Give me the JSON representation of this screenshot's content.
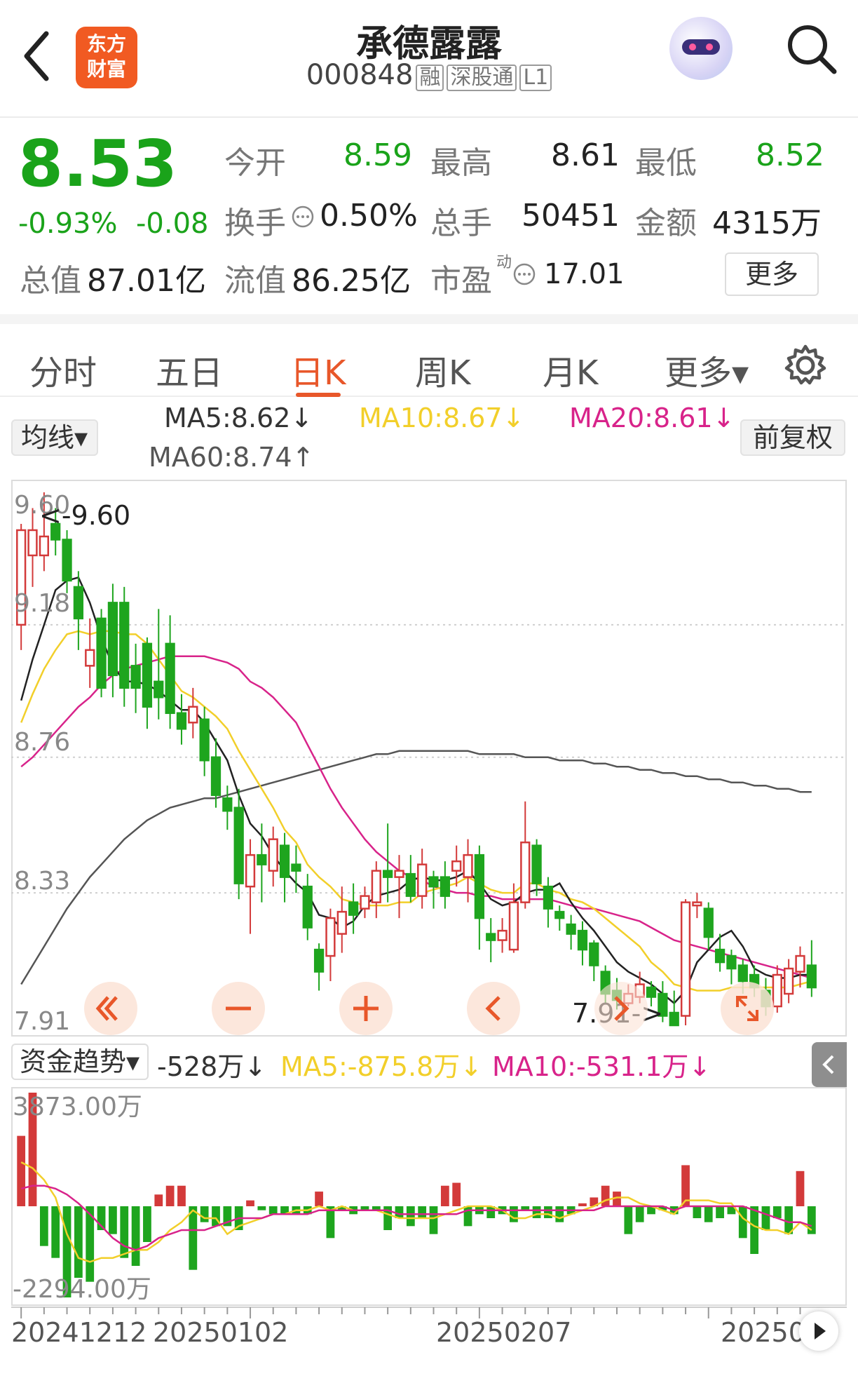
{
  "header": {
    "back_label": "back",
    "logo_text_1": "东方",
    "logo_text_2": "财富",
    "stock_name": "承德露露",
    "stock_code": "000848",
    "tags": [
      "融",
      "深股通",
      "L1"
    ]
  },
  "quote": {
    "price": "8.53",
    "change_pct": "-0.93%",
    "change_abs": "-0.08",
    "open_label": "今开",
    "open": "8.59",
    "high_label": "最高",
    "high": "8.61",
    "low_label": "最低",
    "low": "8.52",
    "turnover_label": "换手",
    "turnover": "0.50%",
    "volume_label": "总手",
    "volume": "50451",
    "amount_label": "金额",
    "amount": "4315万",
    "mktcap_label": "总值",
    "mktcap": "87.01亿",
    "float_label": "流值",
    "float_cap": "86.25亿",
    "pe_label": "市盈",
    "pe_sup": "动",
    "pe": "17.01",
    "more_label": "更多"
  },
  "tabs": [
    "分时",
    "五日",
    "日K",
    "周K",
    "月K",
    "更多▾"
  ],
  "active_tab": "日K",
  "kline": {
    "indicator_select": "均线▾",
    "ma5": "MA5:8.62↓",
    "ma10": "MA10:8.67↓",
    "ma20": "MA20:8.61↓",
    "ma60": "MA60:8.74↑",
    "adjust_button": "前复权",
    "y_ticks": [
      "9.60",
      "9.18",
      "8.76",
      "8.33",
      "7.91"
    ],
    "high_marker": "<-9.60",
    "low_marker": "7.91->",
    "colors": {
      "ma5": "#222222",
      "ma10": "#f2cf2a",
      "ma20": "#d8238a",
      "ma60": "#555555",
      "up": "#d33a3a",
      "down": "#1ea51e"
    }
  },
  "fund": {
    "select": "资金趋势▾",
    "value": "-528万↓",
    "ma5": "MA5:-875.8万↓",
    "ma10": "MA10:-531.1万↓",
    "y_top": "3873.00万",
    "y_bottom": "-2294.00万",
    "dates": [
      "20241212",
      "20250102",
      "20250207",
      "20250"
    ]
  },
  "chart_data": {
    "type": "candlestick",
    "ylim": [
      7.91,
      9.6
    ],
    "candles": [
      [
        9.18,
        9.48,
        9.5,
        9.1
      ],
      [
        9.4,
        9.48,
        9.55,
        9.3
      ],
      [
        9.4,
        9.46,
        9.6,
        9.35
      ],
      [
        9.5,
        9.45,
        9.55,
        9.4
      ],
      [
        9.45,
        9.32,
        9.48,
        9.28
      ],
      [
        9.3,
        9.2,
        9.35,
        9.1
      ],
      [
        9.05,
        9.1,
        9.2,
        8.98
      ],
      [
        9.2,
        8.98,
        9.23,
        8.95
      ],
      [
        9.25,
        9.02,
        9.31,
        8.95
      ],
      [
        9.25,
        8.98,
        9.3,
        8.92
      ],
      [
        9.05,
        8.98,
        9.12,
        8.9
      ],
      [
        9.12,
        8.92,
        9.14,
        8.85
      ],
      [
        9.0,
        8.95,
        9.23,
        8.88
      ],
      [
        9.12,
        8.9,
        9.21,
        8.85
      ],
      [
        8.9,
        8.85,
        8.96,
        8.8
      ],
      [
        8.87,
        8.92,
        8.98,
        8.82
      ],
      [
        8.88,
        8.75,
        8.92,
        8.7
      ],
      [
        8.76,
        8.64,
        8.82,
        8.6
      ],
      [
        8.63,
        8.59,
        8.67,
        8.53
      ],
      [
        8.6,
        8.36,
        8.66,
        8.31
      ],
      [
        8.35,
        8.45,
        8.5,
        8.2
      ],
      [
        8.45,
        8.42,
        8.55,
        8.3
      ],
      [
        8.4,
        8.5,
        8.54,
        8.35
      ],
      [
        8.48,
        8.38,
        8.52,
        8.3
      ],
      [
        8.42,
        8.4,
        8.48,
        8.33
      ],
      [
        8.35,
        8.22,
        8.39,
        8.18
      ],
      [
        8.15,
        8.08,
        8.17,
        8.02
      ],
      [
        8.13,
        8.25,
        8.28,
        8.05
      ],
      [
        8.2,
        8.27,
        8.35,
        8.14
      ],
      [
        8.3,
        8.26,
        8.36,
        8.2
      ],
      [
        8.28,
        8.32,
        8.35,
        8.25
      ],
      [
        8.3,
        8.4,
        8.43,
        8.25
      ],
      [
        8.4,
        8.38,
        8.55,
        8.3
      ],
      [
        8.38,
        8.4,
        8.45,
        8.25
      ],
      [
        8.39,
        8.32,
        8.45,
        8.3
      ],
      [
        8.32,
        8.42,
        8.47,
        8.28
      ],
      [
        8.38,
        8.35,
        8.4,
        8.28
      ],
      [
        8.38,
        8.32,
        8.43,
        8.28
      ],
      [
        8.4,
        8.43,
        8.48,
        8.35
      ],
      [
        8.38,
        8.45,
        8.5,
        8.3
      ],
      [
        8.45,
        8.25,
        8.48,
        8.15
      ],
      [
        8.2,
        8.18,
        8.25,
        8.11
      ],
      [
        8.18,
        8.21,
        8.25,
        8.14
      ],
      [
        8.15,
        8.3,
        8.36,
        8.14
      ],
      [
        8.3,
        8.49,
        8.62,
        8.28
      ],
      [
        8.48,
        8.36,
        8.5,
        8.32
      ],
      [
        8.35,
        8.28,
        8.38,
        8.22
      ],
      [
        8.27,
        8.25,
        8.29,
        8.21
      ],
      [
        8.23,
        8.2,
        8.26,
        8.15
      ],
      [
        8.21,
        8.15,
        8.24,
        8.1
      ],
      [
        8.17,
        8.1,
        8.18,
        8.05
      ],
      [
        8.08,
        8.01,
        8.1,
        7.98
      ],
      [
        8.02,
        7.99,
        8.06,
        7.96
      ],
      [
        7.98,
        8.01,
        8.04,
        7.97
      ],
      [
        8.0,
        8.04,
        8.08,
        7.98
      ],
      [
        8.03,
        8.0,
        8.05,
        7.97
      ],
      [
        8.01,
        7.94,
        8.05,
        7.92
      ],
      [
        7.95,
        7.91,
        8.02,
        7.91
      ],
      [
        7.94,
        8.3,
        8.31,
        7.91
      ],
      [
        8.29,
        8.3,
        8.33,
        8.25
      ],
      [
        8.28,
        8.19,
        8.3,
        8.15
      ],
      [
        8.15,
        8.11,
        8.2,
        8.08
      ],
      [
        8.13,
        8.09,
        8.15,
        8.04
      ],
      [
        8.1,
        8.05,
        8.12,
        8.01
      ],
      [
        8.07,
        8.03,
        8.1,
        8.0
      ],
      [
        8.02,
        7.97,
        8.06,
        7.94
      ],
      [
        7.97,
        8.07,
        8.1,
        7.95
      ],
      [
        8.01,
        8.09,
        8.12,
        7.98
      ],
      [
        8.08,
        8.13,
        8.16,
        8.03
      ],
      [
        8.1,
        8.03,
        8.18,
        8.0
      ]
    ],
    "ma5": [
      8.94,
      9.07,
      9.18,
      9.29,
      9.32,
      9.33,
      9.25,
      9.14,
      9.05,
      9.0,
      9.0,
      8.99,
      8.97,
      8.94,
      8.91,
      8.91,
      8.87,
      8.81,
      8.75,
      8.64,
      8.55,
      8.51,
      8.45,
      8.4,
      8.36,
      8.33,
      8.26,
      8.25,
      8.22,
      8.24,
      8.29,
      8.32,
      8.33,
      8.34,
      8.37,
      8.38,
      8.37,
      8.37,
      8.38,
      8.4,
      8.36,
      8.31,
      8.29,
      8.3,
      8.33,
      8.34,
      8.34,
      8.36,
      8.3,
      8.25,
      8.21,
      8.16,
      8.11,
      8.08,
      8.06,
      8.04,
      8.01,
      7.98,
      8.02,
      8.11,
      8.15,
      8.19,
      8.21,
      8.16,
      8.09,
      8.07,
      8.06,
      8.06,
      8.07,
      8.07
    ],
    "ma10": [
      8.87,
      8.96,
      9.04,
      9.1,
      9.15,
      9.16,
      9.15,
      9.16,
      9.16,
      9.15,
      9.15,
      9.12,
      9.07,
      9.02,
      8.97,
      8.95,
      8.92,
      8.89,
      8.85,
      8.78,
      8.72,
      8.66,
      8.6,
      8.53,
      8.49,
      8.42,
      8.38,
      8.35,
      8.31,
      8.3,
      8.29,
      8.29,
      8.29,
      8.3,
      8.3,
      8.33,
      8.34,
      8.35,
      8.36,
      8.38,
      8.36,
      8.34,
      8.33,
      8.33,
      8.36,
      8.36,
      8.34,
      8.33,
      8.31,
      8.3,
      8.28,
      8.25,
      8.22,
      8.19,
      8.16,
      8.11,
      8.08,
      8.04,
      8.03,
      8.02,
      8.02,
      8.02,
      8.03,
      8.03,
      8.03,
      8.03,
      8.03,
      8.03,
      8.04,
      8.05
    ],
    "ma20": [
      8.73,
      8.76,
      8.8,
      8.84,
      8.88,
      8.92,
      8.95,
      8.99,
      9.02,
      9.04,
      9.05,
      9.06,
      9.07,
      9.08,
      9.08,
      9.08,
      9.08,
      9.07,
      9.06,
      9.04,
      9.0,
      8.98,
      8.95,
      8.91,
      8.87,
      8.8,
      8.73,
      8.66,
      8.6,
      8.55,
      8.5,
      8.46,
      8.43,
      8.4,
      8.38,
      8.37,
      8.35,
      8.34,
      8.33,
      8.33,
      8.32,
      8.32,
      8.31,
      8.31,
      8.31,
      8.31,
      8.31,
      8.3,
      8.29,
      8.28,
      8.28,
      8.27,
      8.26,
      8.25,
      8.24,
      8.22,
      8.2,
      8.18,
      8.17,
      8.16,
      8.15,
      8.14,
      8.13,
      8.12,
      8.11,
      8.1,
      8.09,
      8.08,
      8.07,
      8.06
    ],
    "ma60": [
      8.04,
      8.1,
      8.16,
      8.22,
      8.28,
      8.33,
      8.38,
      8.42,
      8.46,
      8.5,
      8.53,
      8.56,
      8.58,
      8.6,
      8.61,
      8.62,
      8.63,
      8.63,
      8.64,
      8.65,
      8.66,
      8.67,
      8.68,
      8.69,
      8.7,
      8.71,
      8.72,
      8.73,
      8.74,
      8.75,
      8.76,
      8.77,
      8.77,
      8.78,
      8.78,
      8.78,
      8.78,
      8.78,
      8.78,
      8.78,
      8.77,
      8.77,
      8.77,
      8.77,
      8.76,
      8.76,
      8.76,
      8.75,
      8.75,
      8.75,
      8.74,
      8.74,
      8.73,
      8.73,
      8.72,
      8.72,
      8.71,
      8.71,
      8.7,
      8.7,
      8.69,
      8.69,
      8.68,
      8.68,
      8.67,
      8.67,
      8.66,
      8.66,
      8.65,
      8.65
    ],
    "fund_flow_wan": [
      2400,
      3873,
      -1000,
      -1300,
      -2294,
      -1800,
      -1900,
      -600,
      -700,
      -1300,
      -1500,
      -900,
      400,
      700,
      700,
      -1600,
      -400,
      -500,
      -500,
      -600,
      200,
      -100,
      -200,
      -200,
      -200,
      -200,
      500,
      -800,
      -100,
      -200,
      -100,
      -100,
      -600,
      -300,
      -500,
      -300,
      -700,
      700,
      800,
      -500,
      -200,
      -300,
      -200,
      -400,
      -100,
      -300,
      -300,
      -400,
      -200,
      100,
      300,
      700,
      500,
      -700,
      -400,
      -200,
      -100,
      -200,
      1400,
      -300,
      -400,
      -300,
      -200,
      -800,
      -1200,
      -600,
      -300,
      -700,
      1200,
      -700
    ],
    "fund_ma5_wan": [
      1500,
      1300,
      900,
      300,
      -700,
      -1300,
      -1400,
      -1300,
      -1300,
      -1200,
      -1100,
      -1100,
      -900,
      -600,
      -400,
      -100,
      -300,
      -300,
      -700,
      -500,
      -400,
      -300,
      -200,
      -200,
      -100,
      -100,
      0,
      -100,
      0,
      -100,
      -100,
      -100,
      -200,
      -300,
      -300,
      -300,
      -300,
      -200,
      -100,
      0,
      0,
      0,
      -100,
      -300,
      -300,
      -200,
      -200,
      -300,
      -200,
      -100,
      0,
      200,
      300,
      300,
      100,
      0,
      -100,
      -200,
      200,
      200,
      200,
      100,
      100,
      -300,
      -500,
      -600,
      -600,
      -700,
      -400,
      -600
    ],
    "fund_ma10_wan": [
      600,
      700,
      700,
      600,
      400,
      100,
      -200,
      -500,
      -800,
      -1000,
      -1100,
      -1000,
      -800,
      -700,
      -600,
      -600,
      -600,
      -500,
      -400,
      -300,
      -300,
      -300,
      -200,
      -200,
      -200,
      -200,
      -100,
      -100,
      -100,
      -100,
      -100,
      -100,
      -100,
      -200,
      -200,
      -200,
      -200,
      -200,
      -200,
      -100,
      -100,
      -100,
      -100,
      -100,
      -100,
      -100,
      -100,
      -100,
      -100,
      -100,
      -100,
      0,
      0,
      0,
      0,
      0,
      0,
      -100,
      0,
      0,
      0,
      0,
      0,
      0,
      -100,
      -200,
      -300,
      -400,
      -400,
      -500
    ]
  }
}
